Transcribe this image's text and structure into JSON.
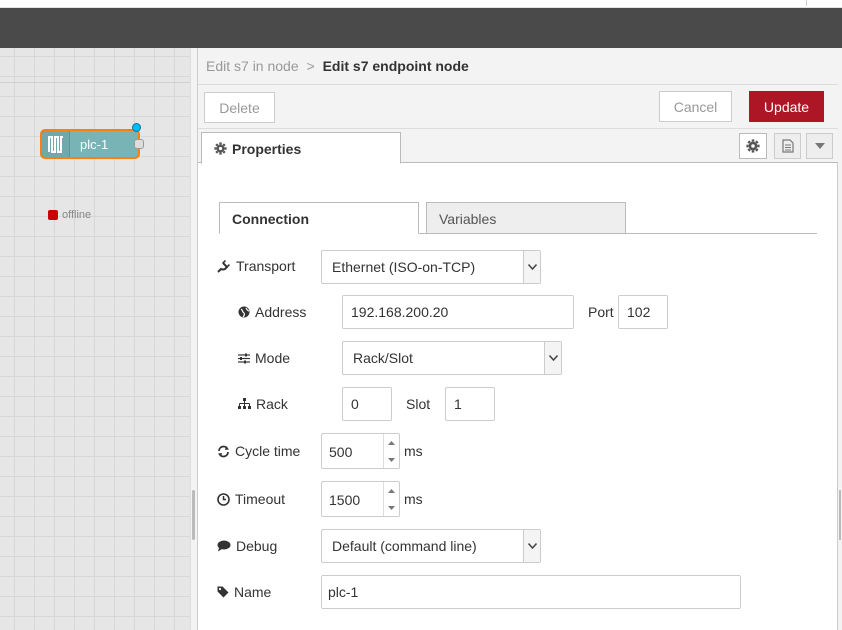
{
  "canvas": {
    "node": {
      "label": "plc-1",
      "status": "offline"
    }
  },
  "editor": {
    "breadcrumb": {
      "parent": "Edit s7 in node",
      "separator": ">",
      "current": "Edit s7 endpoint node"
    },
    "toolbar": {
      "delete_label": "Delete",
      "cancel_label": "Cancel",
      "update_label": "Update"
    },
    "tabs": {
      "properties_label": "Properties"
    },
    "subtabs": [
      {
        "label": "Connection"
      },
      {
        "label": "Variables"
      }
    ],
    "form": {
      "transport": {
        "label": "Transport",
        "value": "Ethernet (ISO-on-TCP)"
      },
      "address": {
        "label": "Address",
        "value": "192.168.200.20"
      },
      "port": {
        "label": "Port",
        "value": "102"
      },
      "mode": {
        "label": "Mode",
        "value": "Rack/Slot"
      },
      "rack": {
        "label": "Rack",
        "value": "0"
      },
      "slot": {
        "label": "Slot",
        "value": "1"
      },
      "cycle_time": {
        "label": "Cycle time",
        "value": "500",
        "unit": "ms"
      },
      "timeout": {
        "label": "Timeout",
        "value": "1500",
        "unit": "ms"
      },
      "debug": {
        "label": "Debug",
        "value": "Default (command line)"
      },
      "name": {
        "label": "Name",
        "value": "plc-1"
      }
    }
  },
  "colors": {
    "header": "#4a4a4a",
    "update_button": "#ad1625",
    "node_fill": "#78b4b6",
    "node_border": "#ff7f0e",
    "status_offline": "#cc0000"
  }
}
